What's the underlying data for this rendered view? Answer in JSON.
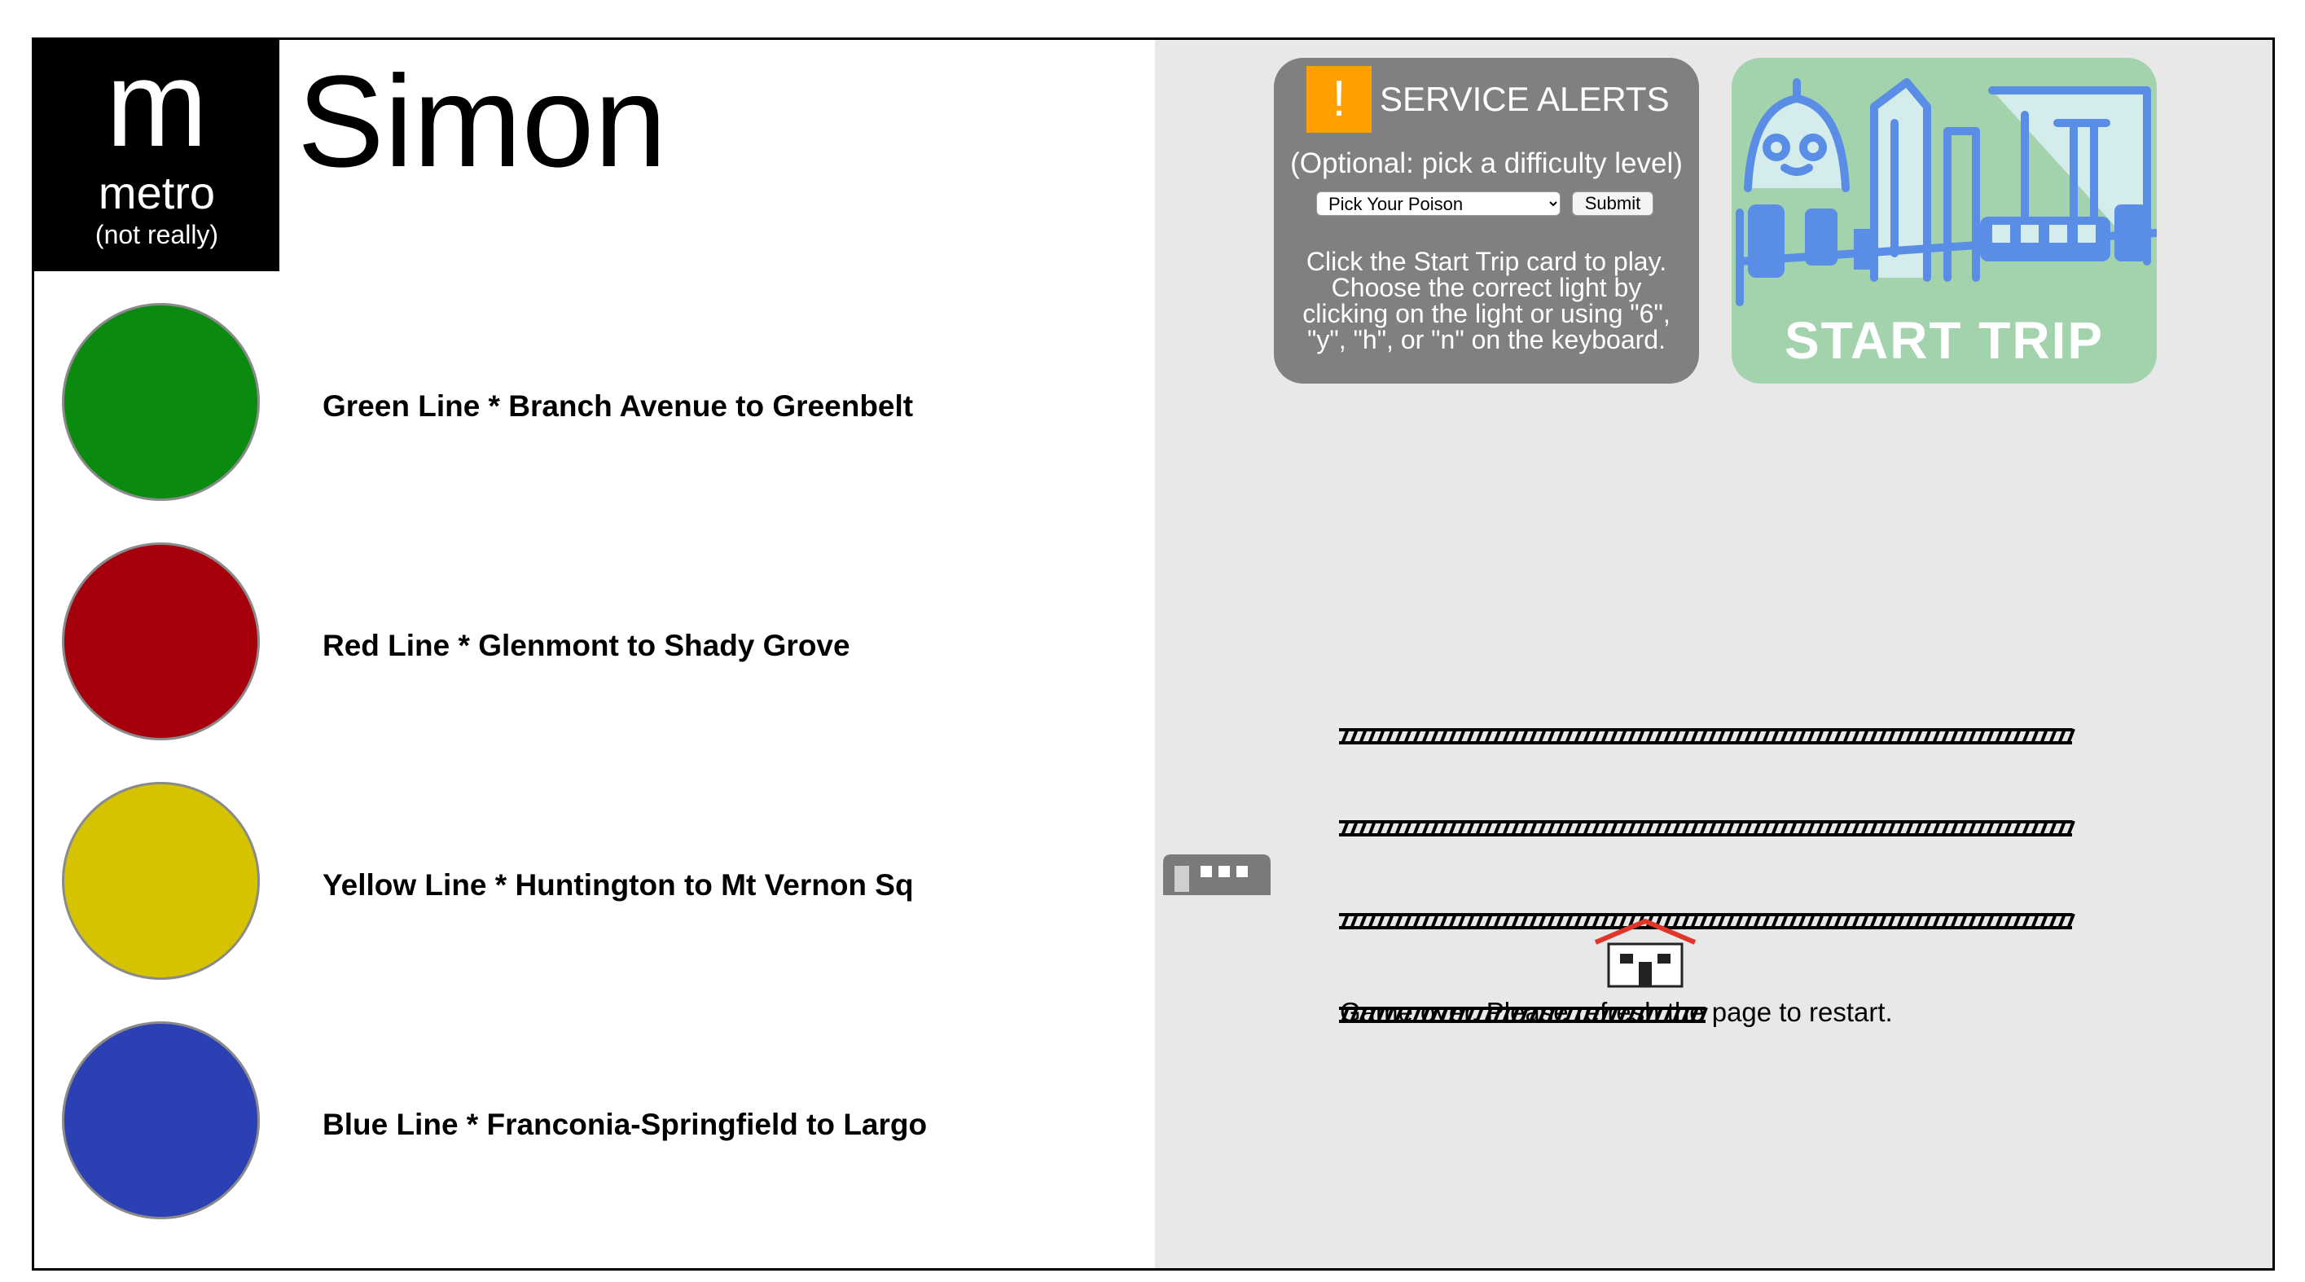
{
  "logo": {
    "letter": "m",
    "word": "metro",
    "subtitle": "(not really)"
  },
  "title": "Simon",
  "lines": [
    {
      "label": "Green Line * Branch Avenue to Greenbelt",
      "color": "#0b8a10"
    },
    {
      "label": "Red Line * Glenmont to Shady Grove",
      "color": "#a6000c"
    },
    {
      "label": "Yellow Line * Huntington to Mt Vernon Sq",
      "color": "#d6c300"
    },
    {
      "label": "Blue Line * Franconia-Springfield to Largo",
      "color": "#2b41b3"
    }
  ],
  "alerts": {
    "icon": "!",
    "title": "SERVICE ALERTS",
    "optional": "(Optional: pick a difficulty level)",
    "select_value": "Pick Your Poison",
    "submit_label": "Submit",
    "instructions": "Click the Start Trip card to play. Choose the correct light by clicking on the light or using \"6\", \"y\", \"h\", or \"n\" on the keyboard."
  },
  "start_trip": {
    "label": "START TRIP"
  },
  "game_over": "Game over. Please refresh the page to restart.",
  "colors": {
    "panel_bg": "#e8e8e8",
    "alerts_bg": "#808080",
    "alert_icon": "#ff9f00",
    "start_bg": "#a3d3ad",
    "start_art_blue": "#5a8ee6",
    "train": "#7a7a7a",
    "station_roof": "#e0352b"
  }
}
